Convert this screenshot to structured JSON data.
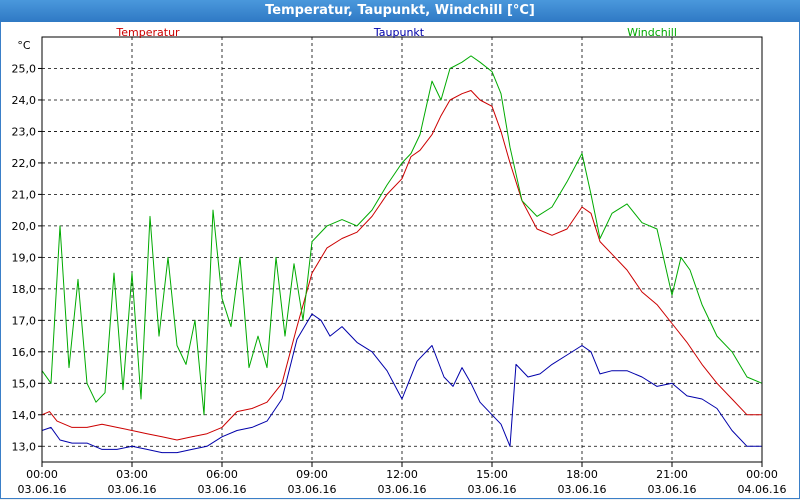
{
  "window": {
    "title": "Temperatur, Taupunkt, Windchill [°C]"
  },
  "chart_data": {
    "type": "line",
    "ylabel": "°C",
    "ylim": [
      12.5,
      26.0
    ],
    "yticks": [
      13.0,
      14.0,
      15.0,
      16.0,
      17.0,
      18.0,
      19.0,
      20.0,
      21.0,
      22.0,
      23.0,
      24.0,
      25.0
    ],
    "ytick_labels": [
      "13,0",
      "14,0",
      "15,0",
      "16,0",
      "17,0",
      "18,0",
      "19,0",
      "20,0",
      "21,0",
      "22,0",
      "23,0",
      "24,0",
      "25,0"
    ],
    "xlim": [
      0,
      24
    ],
    "xticks": [
      {
        "hours": 0,
        "time": "00:00",
        "date": "03.06.16"
      },
      {
        "hours": 3,
        "time": "03:00",
        "date": "03.06.16"
      },
      {
        "hours": 6,
        "time": "06:00",
        "date": "03.06.16"
      },
      {
        "hours": 9,
        "time": "09:00",
        "date": "03.06.16"
      },
      {
        "hours": 12,
        "time": "12:00",
        "date": "03.06.16"
      },
      {
        "hours": 15,
        "time": "15:00",
        "date": "03.06.16"
      },
      {
        "hours": 18,
        "time": "18:00",
        "date": "03.06.16"
      },
      {
        "hours": 21,
        "time": "21:00",
        "date": "03.06.16"
      },
      {
        "hours": 24,
        "time": "00:00",
        "date": "04.06.16"
      }
    ],
    "grid": true,
    "legend_position": "top",
    "series": [
      {
        "name": "Temperatur",
        "color": "#cc0000",
        "points": [
          [
            0,
            14.0
          ],
          [
            0.25,
            14.1
          ],
          [
            0.5,
            13.8
          ],
          [
            1,
            13.6
          ],
          [
            1.5,
            13.6
          ],
          [
            2,
            13.7
          ],
          [
            2.5,
            13.6
          ],
          [
            3,
            13.5
          ],
          [
            3.5,
            13.4
          ],
          [
            4,
            13.3
          ],
          [
            4.5,
            13.2
          ],
          [
            5,
            13.3
          ],
          [
            5.5,
            13.4
          ],
          [
            6,
            13.6
          ],
          [
            6.5,
            14.1
          ],
          [
            7,
            14.2
          ],
          [
            7.5,
            14.4
          ],
          [
            8,
            15.0
          ],
          [
            8.5,
            16.8
          ],
          [
            9,
            18.5
          ],
          [
            9.5,
            19.3
          ],
          [
            10,
            19.6
          ],
          [
            10.5,
            19.8
          ],
          [
            11,
            20.3
          ],
          [
            11.5,
            21.0
          ],
          [
            12,
            21.5
          ],
          [
            12.3,
            22.2
          ],
          [
            12.6,
            22.4
          ],
          [
            13,
            22.9
          ],
          [
            13.3,
            23.5
          ],
          [
            13.6,
            24.0
          ],
          [
            14,
            24.2
          ],
          [
            14.3,
            24.3
          ],
          [
            14.6,
            24.0
          ],
          [
            15,
            23.8
          ],
          [
            15.3,
            23.0
          ],
          [
            15.6,
            22.0
          ],
          [
            16,
            20.8
          ],
          [
            16.5,
            19.9
          ],
          [
            17,
            19.7
          ],
          [
            17.5,
            19.9
          ],
          [
            18,
            20.6
          ],
          [
            18.3,
            20.4
          ],
          [
            18.6,
            19.5
          ],
          [
            19,
            19.1
          ],
          [
            19.5,
            18.6
          ],
          [
            20,
            17.9
          ],
          [
            20.5,
            17.5
          ],
          [
            21,
            16.9
          ],
          [
            21.5,
            16.3
          ],
          [
            22,
            15.6
          ],
          [
            22.5,
            15.0
          ],
          [
            23,
            14.5
          ],
          [
            23.5,
            14.0
          ],
          [
            24,
            14.0
          ]
        ]
      },
      {
        "name": "Taupunkt",
        "color": "#0000aa",
        "points": [
          [
            0,
            13.5
          ],
          [
            0.3,
            13.6
          ],
          [
            0.6,
            13.2
          ],
          [
            1,
            13.1
          ],
          [
            1.5,
            13.1
          ],
          [
            2,
            12.9
          ],
          [
            2.5,
            12.9
          ],
          [
            3,
            13.0
          ],
          [
            3.5,
            12.9
          ],
          [
            4,
            12.8
          ],
          [
            4.5,
            12.8
          ],
          [
            5,
            12.9
          ],
          [
            5.5,
            13.0
          ],
          [
            6,
            13.3
          ],
          [
            6.5,
            13.5
          ],
          [
            7,
            13.6
          ],
          [
            7.5,
            13.8
          ],
          [
            8,
            14.5
          ],
          [
            8.5,
            16.4
          ],
          [
            9,
            17.2
          ],
          [
            9.3,
            17.0
          ],
          [
            9.6,
            16.5
          ],
          [
            10,
            16.8
          ],
          [
            10.5,
            16.3
          ],
          [
            11,
            16.0
          ],
          [
            11.5,
            15.4
          ],
          [
            12,
            14.5
          ],
          [
            12.5,
            15.7
          ],
          [
            13,
            16.2
          ],
          [
            13.4,
            15.2
          ],
          [
            13.7,
            14.9
          ],
          [
            14,
            15.5
          ],
          [
            14.3,
            15.0
          ],
          [
            14.6,
            14.4
          ],
          [
            15,
            14.0
          ],
          [
            15.3,
            13.7
          ],
          [
            15.6,
            13.0
          ],
          [
            15.8,
            15.6
          ],
          [
            16.2,
            15.2
          ],
          [
            16.6,
            15.3
          ],
          [
            17,
            15.6
          ],
          [
            17.5,
            15.9
          ],
          [
            18,
            16.2
          ],
          [
            18.3,
            16.0
          ],
          [
            18.6,
            15.3
          ],
          [
            19,
            15.4
          ],
          [
            19.5,
            15.4
          ],
          [
            20,
            15.2
          ],
          [
            20.5,
            14.9
          ],
          [
            21,
            15.0
          ],
          [
            21.5,
            14.6
          ],
          [
            22,
            14.5
          ],
          [
            22.5,
            14.2
          ],
          [
            23,
            13.5
          ],
          [
            23.5,
            13.0
          ],
          [
            24,
            13.0
          ]
        ]
      },
      {
        "name": "Windchill",
        "color": "#00aa00",
        "points": [
          [
            0,
            15.4
          ],
          [
            0.3,
            15.0
          ],
          [
            0.6,
            20.0
          ],
          [
            0.9,
            15.5
          ],
          [
            1.2,
            18.3
          ],
          [
            1.5,
            15.0
          ],
          [
            1.8,
            14.4
          ],
          [
            2.1,
            14.7
          ],
          [
            2.4,
            18.5
          ],
          [
            2.7,
            14.8
          ],
          [
            3.0,
            18.5
          ],
          [
            3.3,
            14.5
          ],
          [
            3.6,
            20.3
          ],
          [
            3.9,
            16.5
          ],
          [
            4.2,
            19.0
          ],
          [
            4.5,
            16.2
          ],
          [
            4.8,
            15.6
          ],
          [
            5.1,
            17.0
          ],
          [
            5.4,
            14.0
          ],
          [
            5.7,
            20.5
          ],
          [
            6.0,
            17.7
          ],
          [
            6.3,
            16.8
          ],
          [
            6.6,
            19.0
          ],
          [
            6.9,
            15.5
          ],
          [
            7.2,
            16.5
          ],
          [
            7.5,
            15.5
          ],
          [
            7.8,
            19.0
          ],
          [
            8.1,
            16.5
          ],
          [
            8.4,
            18.8
          ],
          [
            8.7,
            17.0
          ],
          [
            9,
            19.5
          ],
          [
            9.5,
            20.0
          ],
          [
            10,
            20.2
          ],
          [
            10.5,
            20.0
          ],
          [
            11,
            20.5
          ],
          [
            11.5,
            21.3
          ],
          [
            12,
            22.0
          ],
          [
            12.3,
            22.3
          ],
          [
            12.6,
            22.9
          ],
          [
            13,
            24.6
          ],
          [
            13.3,
            24.0
          ],
          [
            13.6,
            25.0
          ],
          [
            14,
            25.2
          ],
          [
            14.3,
            25.4
          ],
          [
            14.6,
            25.2
          ],
          [
            15,
            24.9
          ],
          [
            15.3,
            24.2
          ],
          [
            15.6,
            22.5
          ],
          [
            16,
            20.8
          ],
          [
            16.5,
            20.3
          ],
          [
            17,
            20.6
          ],
          [
            17.5,
            21.4
          ],
          [
            18,
            22.3
          ],
          [
            18.3,
            21.0
          ],
          [
            18.6,
            19.6
          ],
          [
            19,
            20.4
          ],
          [
            19.5,
            20.7
          ],
          [
            20,
            20.1
          ],
          [
            20.5,
            19.9
          ],
          [
            21,
            17.8
          ],
          [
            21.3,
            19.0
          ],
          [
            21.6,
            18.6
          ],
          [
            22,
            17.5
          ],
          [
            22.5,
            16.5
          ],
          [
            23,
            16.0
          ],
          [
            23.5,
            15.2
          ],
          [
            24,
            15.0
          ]
        ]
      }
    ]
  }
}
